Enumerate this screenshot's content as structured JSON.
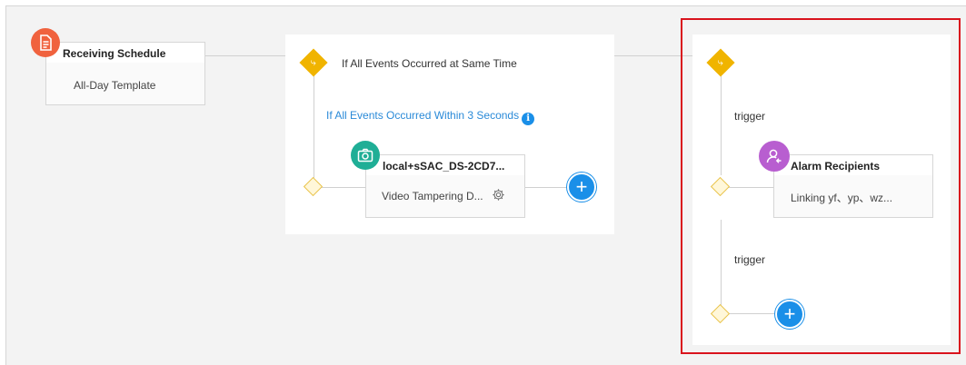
{
  "schedule_card": {
    "title": "Receiving Schedule",
    "template": "All-Day Template",
    "icon": "document-icon"
  },
  "condition_panel": {
    "mode_label": "If All Events Occurred at Same Time",
    "within_link": "If All Events Occurred Within 3 Seconds",
    "info_glyph": "i",
    "event_card": {
      "title": "local+sSAC_DS-2CD7...",
      "event": "Video Tampering D...",
      "icon": "camera-icon",
      "settings_icon": "gear-icon"
    },
    "add_glyph": "+"
  },
  "action_panel": {
    "trigger_label_1": "trigger",
    "trigger_label_2": "trigger",
    "recipients_card": {
      "title": "Alarm Recipients",
      "linking": "Linking yf、yp、wz...",
      "icon": "user-icon"
    },
    "add_glyph": "+"
  },
  "colors": {
    "accent_blue": "#1a8fe8",
    "branch_yellow": "#f0b400",
    "highlight_red": "#d9141d",
    "schedule_orange": "#f0623e",
    "camera_teal": "#1fae96",
    "user_purple": "#b85ed0"
  }
}
